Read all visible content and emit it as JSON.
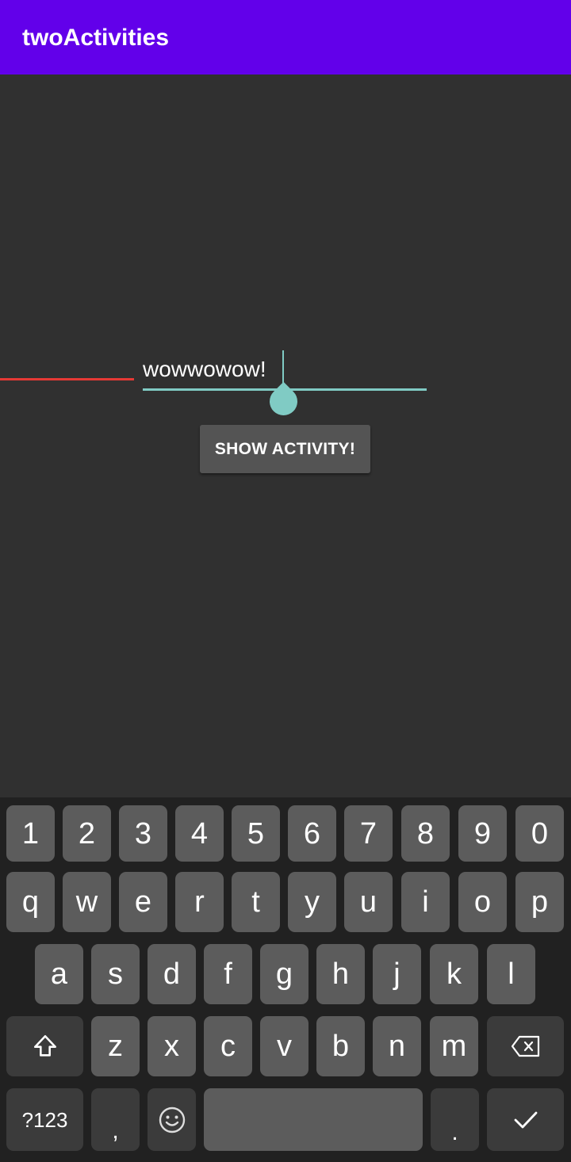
{
  "app": {
    "title": "twoActivities"
  },
  "main": {
    "input_value": "wowwowow!",
    "button_label": "SHOW ACTIVITY!"
  },
  "keyboard": {
    "row_numbers": [
      "1",
      "2",
      "3",
      "4",
      "5",
      "6",
      "7",
      "8",
      "9",
      "0"
    ],
    "row_top": [
      "q",
      "w",
      "e",
      "r",
      "t",
      "y",
      "u",
      "i",
      "o",
      "p"
    ],
    "row_middle": [
      "a",
      "s",
      "d",
      "f",
      "g",
      "h",
      "j",
      "k",
      "l"
    ],
    "row_bottom": [
      "z",
      "x",
      "c",
      "v",
      "b",
      "n",
      "m"
    ],
    "symbols_label": "?123",
    "comma": ",",
    "period": ".",
    "shift_icon": "shift-icon",
    "backspace_icon": "backspace-icon",
    "emoji_icon": "emoji-icon",
    "enter_icon": "checkmark-icon"
  },
  "colors": {
    "app_bar": "#6200ea",
    "background": "#303030",
    "accent": "#80cbc4",
    "button": "#545454",
    "spell_error": "#e53935"
  }
}
